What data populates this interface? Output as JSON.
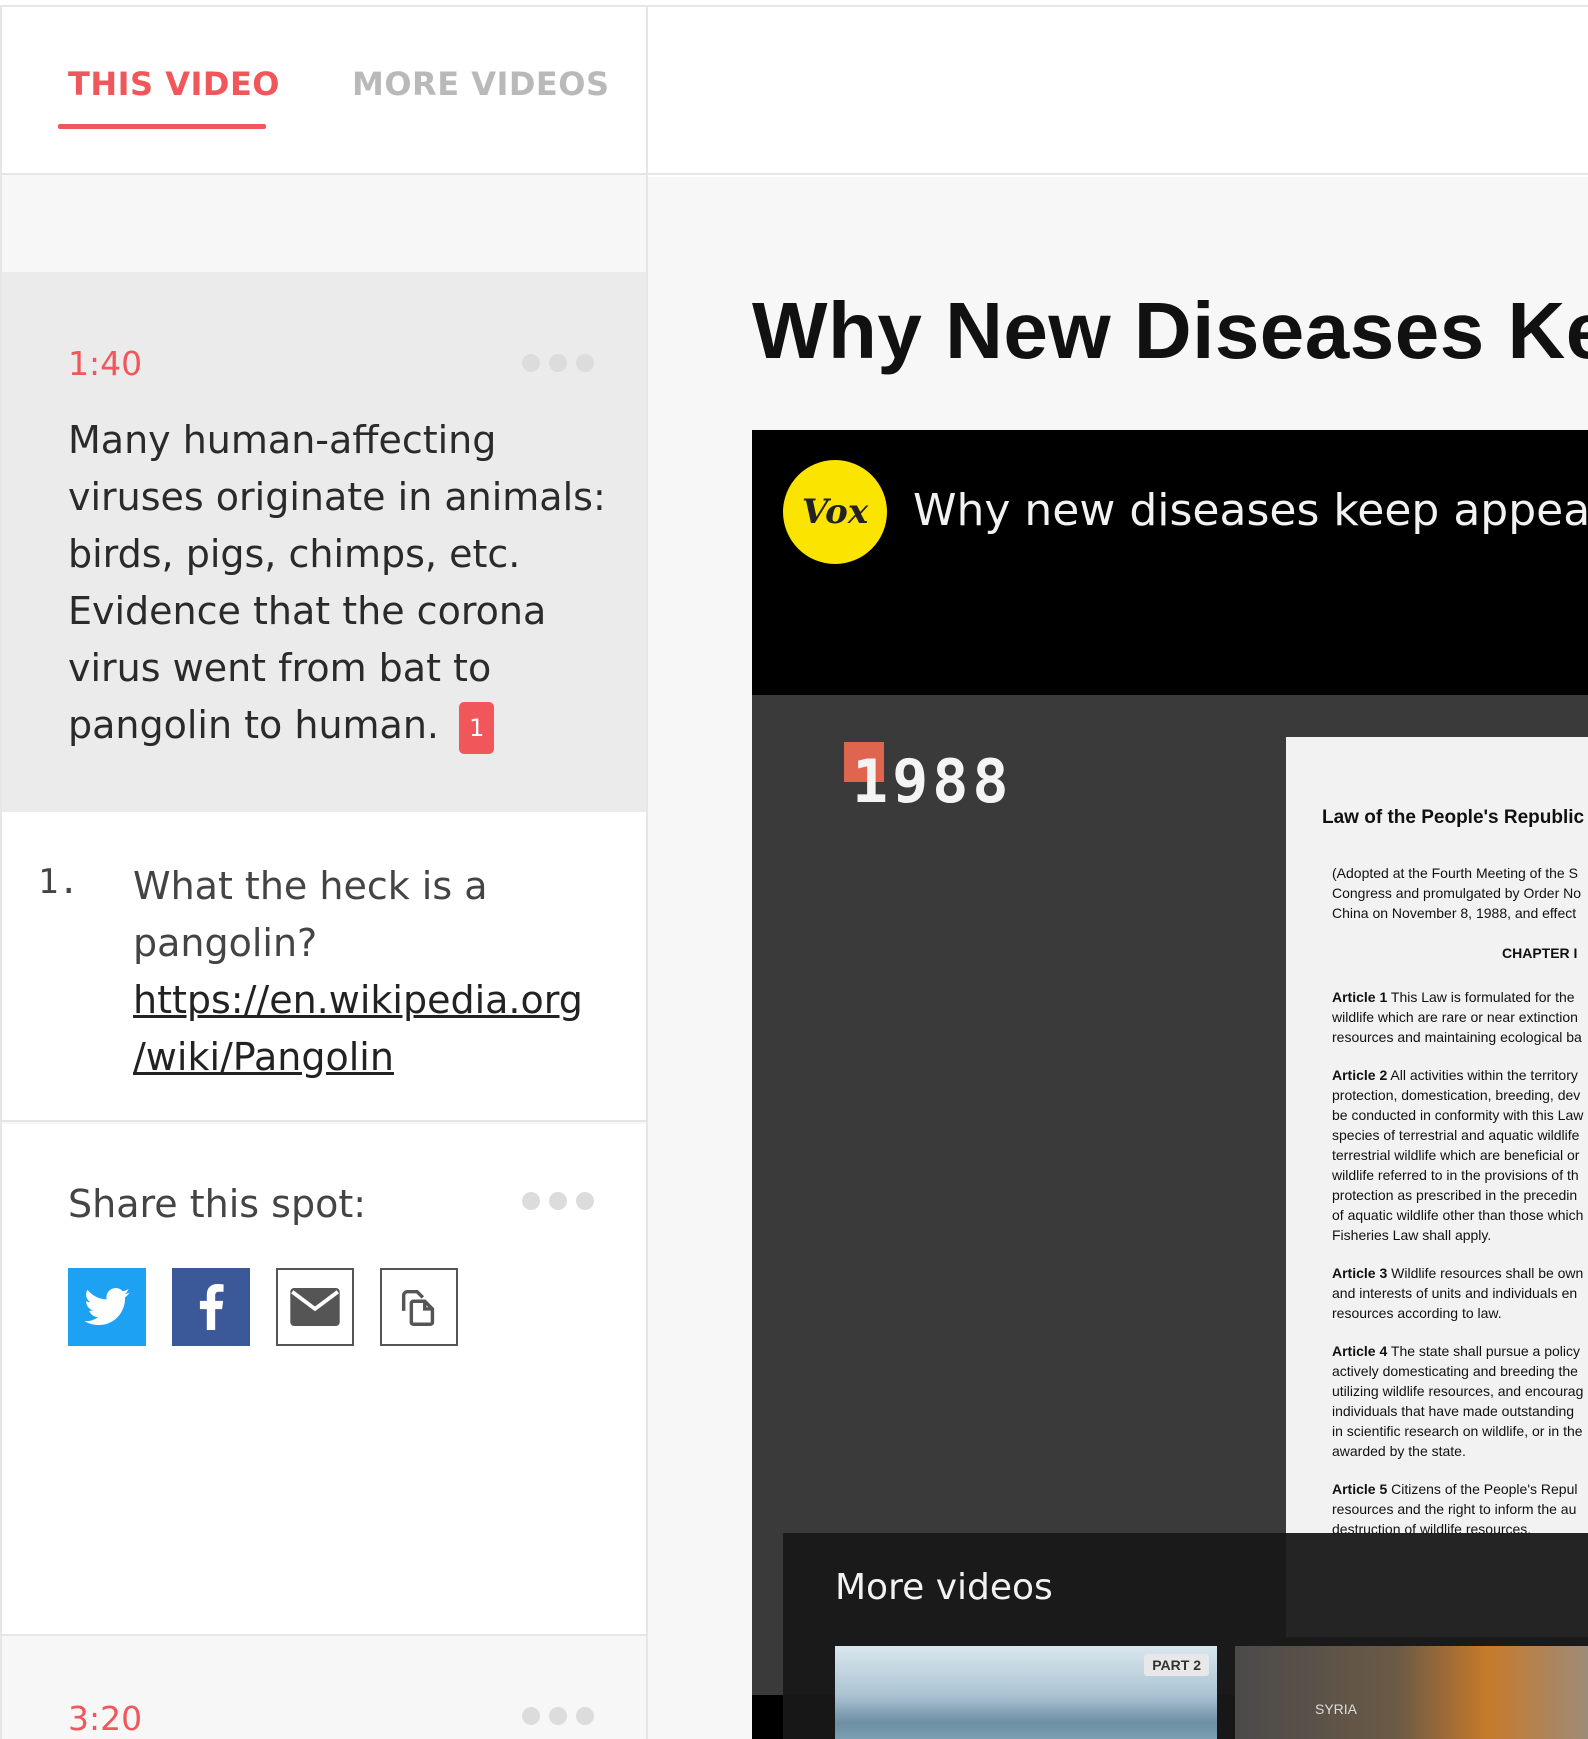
{
  "tabs": {
    "this_video": "THIS VIDEO",
    "more_videos": "MORE VIDEOS"
  },
  "active_note": {
    "timestamp": "1:40",
    "text": "Many human-affecting viruses originate in animals: birds, pigs, chimps, etc. Evidence that the corona virus went from bat to pangolin to human.",
    "ref_badge": "1"
  },
  "references": [
    {
      "number": "1.",
      "text": "What the heck is a pangolin?",
      "link_line1": "https://en.wikipedia.org",
      "link_line2": "/wiki/Pangolin"
    }
  ],
  "share": {
    "label": "Share this spot:",
    "buttons": [
      "twitter-icon",
      "facebook-icon",
      "email-icon",
      "copy-icon"
    ]
  },
  "next_note": {
    "timestamp": "3:20"
  },
  "main": {
    "page_title": "Why New Diseases Ke"
  },
  "player": {
    "channel_logo": "Vox",
    "video_title": "Why new diseases keep appearin",
    "frame": {
      "year": "1988",
      "doc_title": "Law of the People's Republic",
      "doc_sub": [
        "(Adopted at the Fourth Meeting of the S",
        "Congress and promulgated by Order No",
        "China on November 8, 1988, and effect"
      ],
      "chapter": "CHAPTER I",
      "articles": [
        {
          "head": "Article 1",
          "lines": [
            "This Law is formulated for the",
            "wildlife which are rare or near extinction",
            "resources and maintaining ecological ba"
          ]
        },
        {
          "head": "Article 2",
          "lines": [
            "All activities within the territory",
            "protection, domestication, breeding, dev",
            "be conducted in conformity with this Law",
            "species of terrestrial and aquatic wildlife",
            "terrestrial wildlife which are beneficial or",
            "wildlife referred to in the provisions of th",
            "protection as prescribed in the precedin",
            "of aquatic wildlife other than those which",
            "Fisheries Law shall apply."
          ]
        },
        {
          "head": "Article 3",
          "lines": [
            "Wildlife resources shall be own",
            "and interests of units and individuals en",
            "resources according to law."
          ]
        },
        {
          "head": "Article 4",
          "lines": [
            "The state shall pursue a policy",
            "actively domesticating and breeding the",
            "utilizing wildlife resources, and encourag",
            "individuals that have made outstanding",
            "in scientific research on wildlife, or in the",
            "awarded by the state."
          ]
        },
        {
          "head": "Article 5",
          "lines": [
            "Citizens of the People's Repul",
            "resources and the right to inform the au",
            "destruction of wildlife resources."
          ]
        }
      ]
    },
    "more_videos": {
      "label": "More videos",
      "thumb1_badge": "PART 2",
      "thumb2_label": "SYRIA"
    }
  },
  "colors": {
    "accent": "#f0565a",
    "twitter": "#1da1f2",
    "facebook": "#3b5998",
    "vox_yellow": "#fbe400"
  }
}
